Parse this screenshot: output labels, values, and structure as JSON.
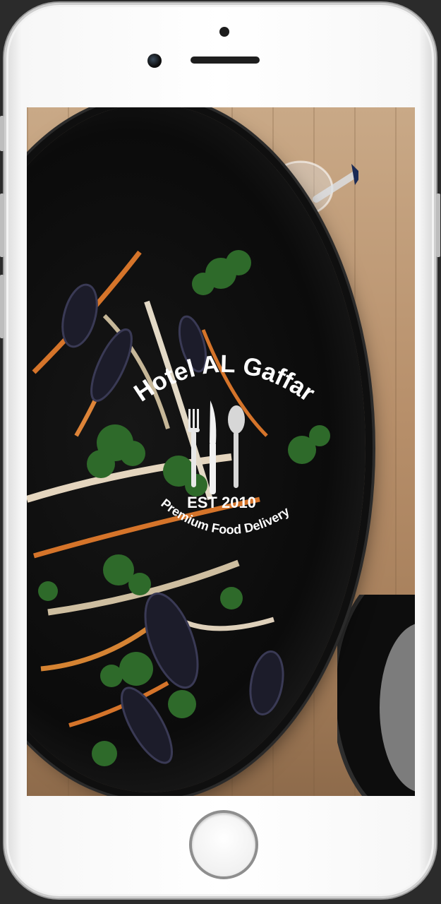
{
  "splash": {
    "brand_name": "Hotel AL Gaffar",
    "established": "EST 2010",
    "tagline": "Premium Food Delivery",
    "logo_icons": [
      "fork-icon",
      "knife-icon",
      "spoon-icon"
    ]
  },
  "device": {
    "model": "iphone",
    "frame_color": "#ffffff"
  },
  "colors": {
    "logo_text": "#ffffff",
    "pan": "#0b0b0b",
    "table_wood": "#b78f6a"
  }
}
